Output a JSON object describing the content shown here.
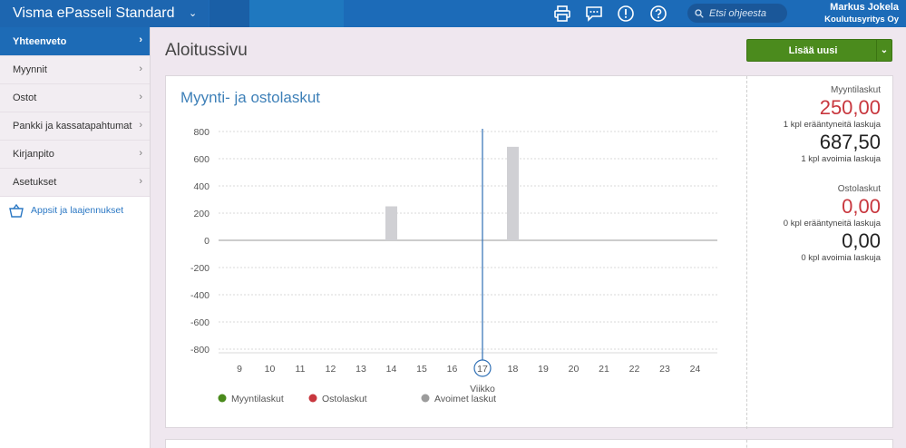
{
  "topbar": {
    "brand": "Visma ePasseli Standard",
    "search_placeholder": "Etsi ohjeesta",
    "user_name": "Markus Jokela",
    "company": "Koulutusyritys Oy",
    "icons": [
      "printer-icon",
      "chat-icon",
      "alert-icon",
      "help-icon",
      "search-icon"
    ]
  },
  "sidebar": {
    "items": [
      {
        "label": "Yhteenveto",
        "active": true
      },
      {
        "label": "Myynnit"
      },
      {
        "label": "Ostot"
      },
      {
        "label": "Pankki ja kassatapahtumat"
      },
      {
        "label": "Kirjanpito"
      },
      {
        "label": "Asetukset"
      }
    ],
    "apps_label": "Appsit ja laajennukset"
  },
  "main": {
    "title": "Aloitussivu",
    "add_button": "Lisää uusi"
  },
  "summary": {
    "sales_header": "Myyntilaskut",
    "sales_overdue_amount": "250,00",
    "sales_overdue_text": "1 kpl erääntyneitä laskuja",
    "sales_open_amount": "687,50",
    "sales_open_text": "1 kpl avoimia laskuja",
    "purchase_header": "Ostolaskut",
    "purchase_overdue_amount": "0,00",
    "purchase_overdue_text": "0 kpl erääntyneitä laskuja",
    "purchase_open_amount": "0,00",
    "purchase_open_text": "0 kpl avoimia laskuja"
  },
  "colors": {
    "brand": "#1c6bb8",
    "accent_green": "#4b8b1d",
    "red": "#c8373e",
    "bar_grey": "#d0d0d4",
    "sales_green": "#4a8a1c",
    "purchase_red": "#c8373e",
    "open_grey": "#9c9c9c"
  },
  "chart_data": {
    "type": "bar",
    "title": "Myynti- ja ostolaskut",
    "xlabel": "Viikko",
    "ylabel": "",
    "categories": [
      "9",
      "10",
      "11",
      "12",
      "13",
      "14",
      "15",
      "16",
      "17",
      "18",
      "19",
      "20",
      "21",
      "22",
      "23",
      "24"
    ],
    "current_week": "17",
    "ylim": [
      -800,
      800
    ],
    "yticks": [
      800,
      600,
      400,
      200,
      0,
      -200,
      -400,
      -600,
      -800
    ],
    "grid": true,
    "legend_position": "bottom",
    "series": [
      {
        "name": "Myyntilaskut",
        "color": "#4a8a1c",
        "values": [
          0,
          0,
          0,
          0,
          0,
          0,
          0,
          0,
          0,
          0,
          0,
          0,
          0,
          0,
          0,
          0
        ]
      },
      {
        "name": "Ostolaskut",
        "color": "#c8373e",
        "values": [
          0,
          0,
          0,
          0,
          0,
          0,
          0,
          0,
          0,
          0,
          0,
          0,
          0,
          0,
          0,
          0
        ]
      },
      {
        "name": "Avoimet laskut",
        "color": "#9c9c9c",
        "values": [
          0,
          0,
          0,
          0,
          0,
          250,
          0,
          0,
          0,
          687.5,
          0,
          0,
          0,
          0,
          0,
          0
        ]
      }
    ]
  }
}
